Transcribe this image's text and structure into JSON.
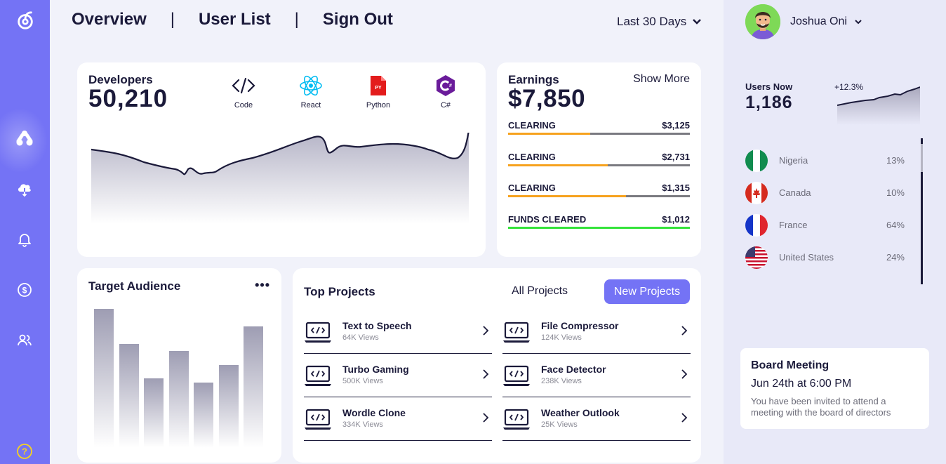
{
  "nav": {
    "overview": "Overview",
    "sep1": "|",
    "user_list": "User List",
    "sep2": "|",
    "sign_out": "Sign Out",
    "range": "Last 30 Days"
  },
  "developers": {
    "title": "Developers",
    "count": "50,210",
    "techs": [
      {
        "label": "Code",
        "icon": "code-icon"
      },
      {
        "label": "React",
        "icon": "react-icon"
      },
      {
        "label": "Python",
        "icon": "python-icon"
      },
      {
        "label": "C#",
        "icon": "csharp-icon"
      }
    ]
  },
  "earnings": {
    "title": "Earnings",
    "show_more": "Show More",
    "total": "$7,850",
    "rows": [
      {
        "label": "CLEARING",
        "amount": "$3,125",
        "progress": 0.45,
        "color": "#f6a21e"
      },
      {
        "label": "CLEARING",
        "amount": "$2,731",
        "progress": 0.55,
        "color": "#f6a21e"
      },
      {
        "label": "CLEARING",
        "amount": "$1,315",
        "progress": 0.65,
        "color": "#f6a21e"
      },
      {
        "label": "FUNDS CLEARED",
        "amount": "$1,012",
        "progress": 1.0,
        "color": "#35e33b"
      }
    ]
  },
  "audience": {
    "title": "Target Audience",
    "menu": "•••"
  },
  "projects": {
    "title": "Top Projects",
    "all_label": "All Projects",
    "new_label": "New Projects",
    "items": [
      {
        "name": "Text to Speech",
        "views": "64K Views"
      },
      {
        "name": "File Compressor",
        "views": "124K Views"
      },
      {
        "name": "Turbo Gaming",
        "views": "500K Views"
      },
      {
        "name": "Face Detector",
        "views": "238K Views"
      },
      {
        "name": "Wordle Clone",
        "views": "334K Views"
      },
      {
        "name": "Weather Outlook",
        "views": "25K Views"
      }
    ]
  },
  "user": {
    "name": "Joshua Oni"
  },
  "users_now": {
    "label": "Users Now",
    "count": "1,186",
    "change": "+12.3%"
  },
  "countries": [
    {
      "name": "Nigeria",
      "pct": "13%",
      "flag": "nigeria-flag"
    },
    {
      "name": "Canada",
      "pct": "10%",
      "flag": "canada-flag"
    },
    {
      "name": "France",
      "pct": "64%",
      "flag": "france-flag"
    },
    {
      "name": "United States",
      "pct": "24%",
      "flag": "us-flag"
    }
  ],
  "meeting": {
    "title": "Board Meeting",
    "time": "Jun 24th at 6:00 PM",
    "desc": "You have been invited to attend a meeting with the board of directors"
  },
  "colors": {
    "accent": "#7473f5",
    "dark": "#1b1a3a",
    "clearing": "#f6a21e",
    "cleared": "#35e33b"
  }
}
